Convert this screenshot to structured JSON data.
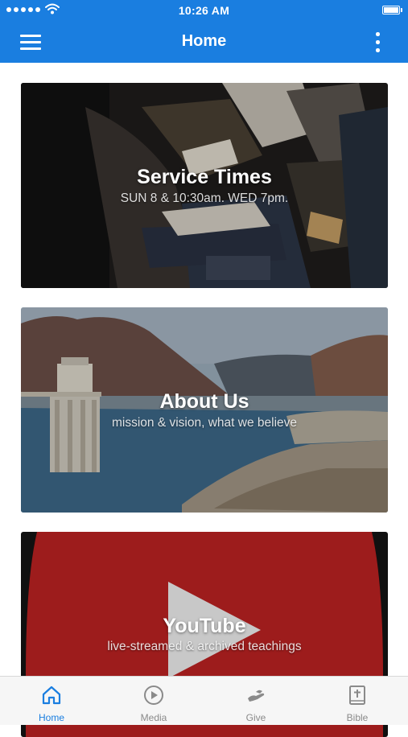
{
  "status_bar": {
    "time": "10:26 AM"
  },
  "nav": {
    "title": "Home"
  },
  "cards": [
    {
      "title": "Service Times",
      "subtitle": "SUN 8 & 10:30am.  WED 7pm."
    },
    {
      "title": "About Us",
      "subtitle": "mission & vision, what we believe"
    },
    {
      "title": "YouTube",
      "subtitle": "live-streamed & archived teachings"
    }
  ],
  "tabs": [
    {
      "label": "Home",
      "icon": "home-icon",
      "active": true
    },
    {
      "label": "Media",
      "icon": "play-circle-icon",
      "active": false
    },
    {
      "label": "Give",
      "icon": "give-icon",
      "active": false
    },
    {
      "label": "Bible",
      "icon": "bible-icon",
      "active": false
    }
  ],
  "colors": {
    "accent": "#1a7ee0",
    "tab_inactive": "#8a8a8a",
    "youtube_red": "#9e1e1e"
  }
}
